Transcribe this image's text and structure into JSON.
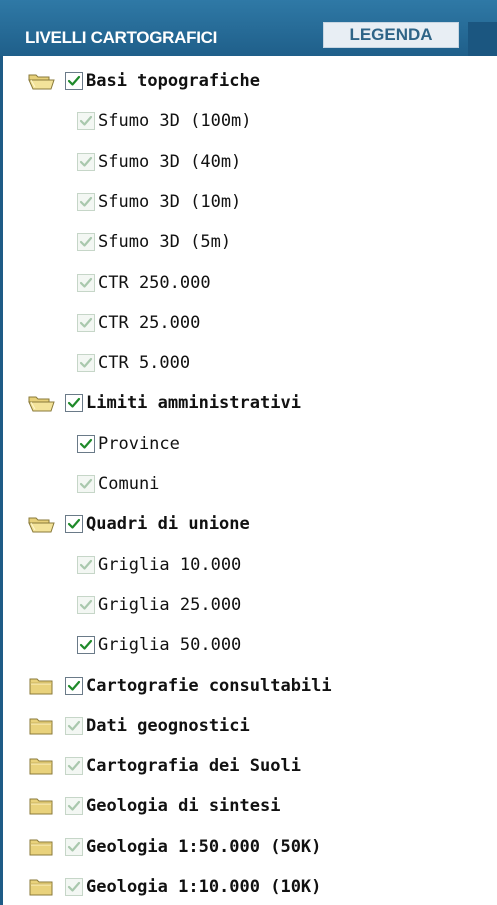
{
  "header": {
    "tab_livelli": "LIVELLI CARTOGRAFICI",
    "tab_legenda": "LEGENDA"
  },
  "icons": {
    "folder_open": "folder-open-icon",
    "folder_closed": "folder-closed-icon",
    "check": "check-icon"
  },
  "colors": {
    "header_blue": "#2f79a6",
    "check_active": "#1f8a2a",
    "check_inactive": "#a9c8ad"
  },
  "tree": [
    {
      "type": "group",
      "folder": "open",
      "checked": "active",
      "label": "Basi topografiche"
    },
    {
      "type": "item",
      "checked": "inactive",
      "label": "Sfumo 3D (100m)"
    },
    {
      "type": "item",
      "checked": "inactive",
      "label": "Sfumo 3D (40m)"
    },
    {
      "type": "item",
      "checked": "inactive",
      "label": "Sfumo 3D (10m)"
    },
    {
      "type": "item",
      "checked": "inactive",
      "label": "Sfumo 3D (5m)"
    },
    {
      "type": "item",
      "checked": "inactive",
      "label": "CTR 250.000"
    },
    {
      "type": "item",
      "checked": "inactive",
      "label": "CTR 25.000"
    },
    {
      "type": "item",
      "checked": "inactive",
      "label": "CTR 5.000"
    },
    {
      "type": "group",
      "folder": "open",
      "checked": "active",
      "label": "Limiti amministrativi"
    },
    {
      "type": "item",
      "checked": "active",
      "label": "Province"
    },
    {
      "type": "item",
      "checked": "inactive",
      "label": "Comuni"
    },
    {
      "type": "group",
      "folder": "open",
      "checked": "active",
      "label": "Quadri di unione"
    },
    {
      "type": "item",
      "checked": "inactive",
      "label": "Griglia 10.000"
    },
    {
      "type": "item",
      "checked": "inactive",
      "label": "Griglia 25.000"
    },
    {
      "type": "item",
      "checked": "active",
      "label": "Griglia 50.000"
    },
    {
      "type": "group",
      "folder": "closed",
      "checked": "active",
      "label": "Cartografie consultabili"
    },
    {
      "type": "group",
      "folder": "closed",
      "checked": "inactive",
      "label": "Dati geognostici"
    },
    {
      "type": "group",
      "folder": "closed",
      "checked": "inactive",
      "label": "Cartografia dei Suoli"
    },
    {
      "type": "group",
      "folder": "closed",
      "checked": "inactive",
      "label": "Geologia di sintesi"
    },
    {
      "type": "group",
      "folder": "closed",
      "checked": "inactive",
      "label": "Geologia 1:50.000 (50K)"
    },
    {
      "type": "group",
      "folder": "closed",
      "checked": "inactive",
      "label": "Geologia 1:10.000 (10K)"
    }
  ]
}
